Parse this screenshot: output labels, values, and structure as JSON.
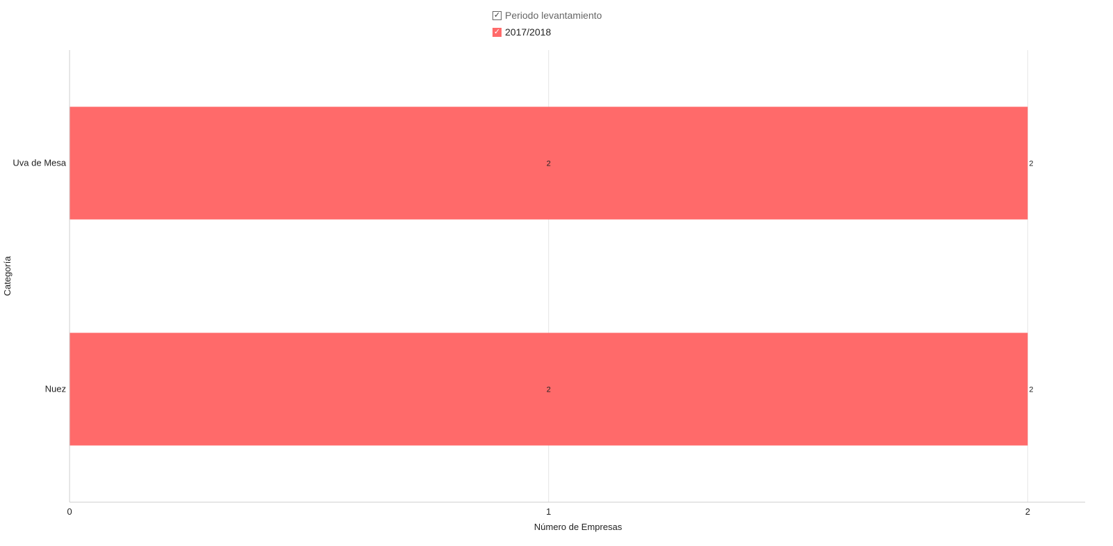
{
  "legend": {
    "title": "Periodo levantamiento",
    "items": [
      {
        "label": "2017/2018",
        "color": "#ff6a6a"
      }
    ],
    "check_glyph": "✓"
  },
  "chart_data": {
    "type": "bar",
    "orientation": "horizontal",
    "categories": [
      "Uva de Mesa",
      "Nuez"
    ],
    "series": [
      {
        "name": "2017/2018",
        "values": [
          2,
          2
        ],
        "color": "#ff6a6a"
      }
    ],
    "xlabel": "Número de Empresas",
    "ylabel": "Categoría",
    "xlim": [
      0,
      2.12
    ],
    "xticks": [
      0,
      1,
      2
    ],
    "grid": true,
    "legend_position": "top-center",
    "data_labels": {
      "center": true,
      "end": true
    }
  }
}
